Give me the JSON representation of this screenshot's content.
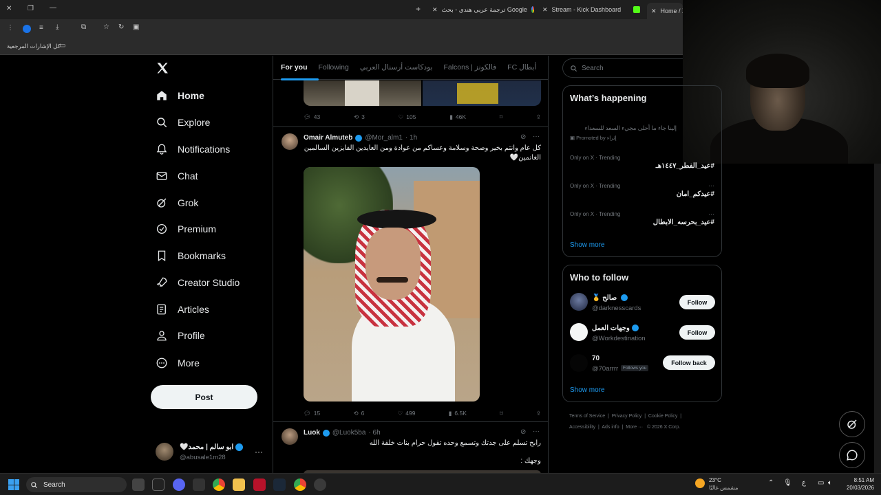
{
  "browser": {
    "tabs": [
      {
        "label": "Home / X"
      },
      {
        "label": "Stream - Kick Dashboard"
      },
      {
        "label": "ترجمة عربي هندي - بحث Google"
      }
    ],
    "bookmarks_label": "كل الإشارات المرجعية"
  },
  "sidebar": {
    "items": [
      {
        "label": "Home",
        "icon": "home-icon"
      },
      {
        "label": "Explore",
        "icon": "search-icon"
      },
      {
        "label": "Notifications",
        "icon": "bell-icon"
      },
      {
        "label": "Chat",
        "icon": "mail-icon"
      },
      {
        "label": "Grok",
        "icon": "grok-icon"
      },
      {
        "label": "Premium",
        "icon": "verified-icon"
      },
      {
        "label": "Bookmarks",
        "icon": "bookmark-icon"
      },
      {
        "label": "Creator Studio",
        "icon": "rocket-icon"
      },
      {
        "label": "Articles",
        "icon": "article-icon"
      },
      {
        "label": "Profile",
        "icon": "person-icon"
      },
      {
        "label": "More",
        "icon": "more-icon"
      }
    ],
    "post_label": "Post",
    "account": {
      "name": "ابو سالم | محمد🤍",
      "handle": "@abusale1m28"
    }
  },
  "timeline": {
    "tabs": [
      "For you",
      "Following",
      "بودكاست أرسنال العربي",
      "Falcons | فالكونز",
      "FC أبطال"
    ],
    "tweet0_stats": {
      "replies": "43",
      "reposts": "3",
      "likes": "105",
      "views": "46K"
    },
    "tweet1": {
      "name": "Omair Almuteb",
      "handle": "@Mor_alm1",
      "time": "· 1h",
      "text": "كل عام وانتم بخير وصحة وسلامة وعساكم من عوادة ومن العايدين الفايزين السالمين الغانمين🤍",
      "replies": "15",
      "reposts": "6",
      "likes": "499",
      "views": "6.5K"
    },
    "tweet2": {
      "name": "Luok",
      "handle": "@Luok5ba",
      "time": "· 6h",
      "text": "رابح تسلم على جدتك وتسمع وحده تقول حرام بنات خلقة الله",
      "text2": "وجهك :"
    }
  },
  "right": {
    "search_placeholder": "Search",
    "happening_title": "What’s happening",
    "promo_text": "إلينا جاء ما أحلى مجيء السعد للسعداء",
    "promo_label": "Promoted by إثراء",
    "trends": [
      {
        "meta": "Only on X · Trending",
        "tag": "#عيد_الفطر_١٤٤٧هـ"
      },
      {
        "meta": "Only on X · Trending",
        "tag": "#عيدكم_امان"
      },
      {
        "meta": "Only on X · Trending",
        "tag": "#عيد_بحرسه_الابطال"
      }
    ],
    "show_more": "Show more",
    "who_title": "Who to follow",
    "who": [
      {
        "name": "صالح 🥇",
        "handle": "@darknesscards",
        "button": "Follow"
      },
      {
        "name": "وجهات العمل",
        "handle": "@Workdestination",
        "button": "Follow"
      },
      {
        "name": "70",
        "handle": "@70arrrr",
        "badge": "Follows you",
        "button": "Follow back"
      }
    ],
    "who_show_more": "Show more",
    "footer": [
      "Terms of Service",
      "Privacy Policy",
      "Cookie Policy",
      "Accessibility",
      "Ads info",
      "More ···",
      "© 2026 X Corp."
    ]
  },
  "taskbar": {
    "search": "Search",
    "weather_temp": "23°C",
    "weather_desc": "مشمس غالبًا",
    "lang": "ع",
    "time": "8:51 AM",
    "date": "20/03/2026"
  }
}
